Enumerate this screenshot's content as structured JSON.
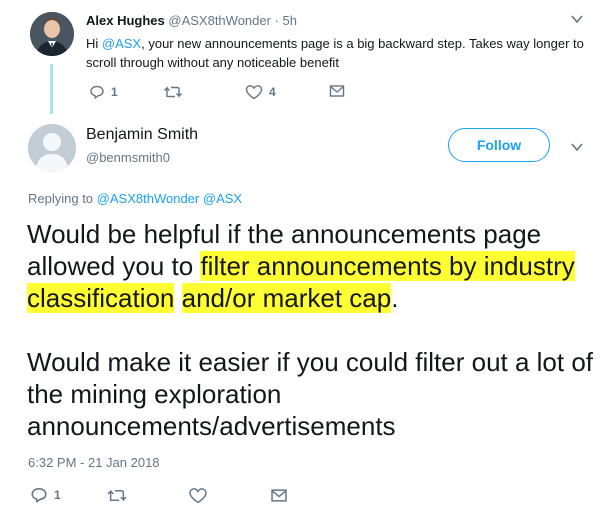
{
  "parent_tweet": {
    "name": "Alex Hughes",
    "handle": "@ASX8thWonder",
    "time": "· 5h",
    "text_prefix": "Hi ",
    "mention": "@ASX",
    "text_suffix": ", your new announcements page is a big backward step. Takes way longer to scroll through without any noticeable benefit",
    "reply_count": "1",
    "retweet_count": "",
    "like_count": "4"
  },
  "main_tweet": {
    "name": "Benjamin Smith",
    "handle": "@benmsmith0",
    "follow_label": "Follow",
    "replying_label": "Replying to",
    "replying_mention_1": "@ASX8thWonder",
    "replying_mention_2": "@ASX",
    "text_p1_a": "Would be helpful if the announcements page allowed you to ",
    "text_p1_hl1": "filter announcements by industry classification",
    "text_p1_b": " ",
    "text_p1_hl2": "and/or market cap",
    "text_p1_c": ".",
    "text_p2": "Would make it easier if you could filter out a lot of the mining exploration announcements/advertisements",
    "timestamp": "6:32 PM - 21 Jan 2018",
    "reply_count": "1"
  },
  "colors": {
    "accent": "#1da1f2",
    "highlight": "#ffff33",
    "muted": "#657786",
    "thread_line": "#a7e4f2"
  }
}
